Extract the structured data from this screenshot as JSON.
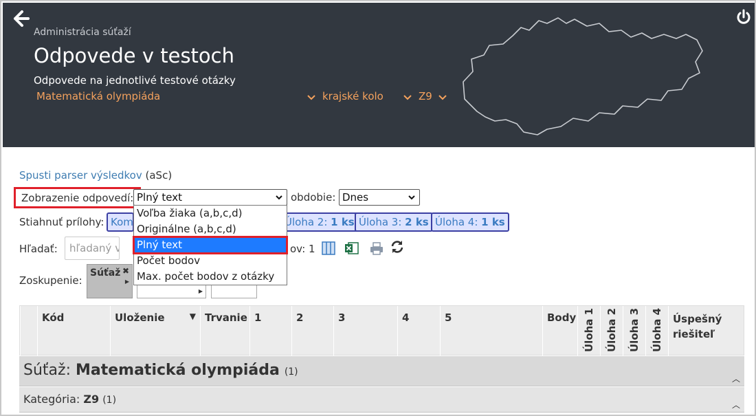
{
  "header": {
    "section": "Administrácia súťaží",
    "title": "Odpovede v testoch",
    "subtitle": "Odpovede na jednotlivé testové otázky",
    "competition": "Matematická olympiáda",
    "round": "krajské kolo",
    "category": "Z9"
  },
  "toolbar": {
    "parser_link": "Spusti parser výsledkov",
    "parser_suffix": "(aSc)",
    "display_label": "Zobrazenie odpovedí:",
    "display_value": "Plný text",
    "period_label": "obdobie:",
    "period_value": "Dnes",
    "attachments_label": "Stiahnuť prílohy:",
    "tag_komplet": "Kom",
    "tag_u2_label": "Úloha 2:",
    "tag_u2_count": "1 ks",
    "tag_u3_label": "Úloha 3:",
    "tag_u3_count": "2 ks",
    "tag_u4_label": "Úloha 4:",
    "tag_u4_count": "1 ks",
    "search_label": "Hľadať:",
    "search_placeholder": "hľadaný výr",
    "count_text": "ov: 1",
    "grouping_label": "Zoskupenie:",
    "group_chip": "Súťaž"
  },
  "dropdown": {
    "options": [
      "Voľba žiaka (a,b,c,d)",
      "Originálne (a,b,c,d)",
      "Plný text",
      "Počet bodov",
      "Max. počet bodov z otázky"
    ]
  },
  "table": {
    "columns": [
      "Kód",
      "Uloženie",
      "Trvanie",
      "1",
      "2",
      "3",
      "4",
      "5",
      "Body",
      "Úloha 1",
      "Úloha 2",
      "Úloha 3",
      "Úloha 4",
      "Úspešný riešiteľ"
    ],
    "group1_label": "Súťaž:",
    "group1_value": "Matematická olympiáda",
    "group1_count": "(1)",
    "group2_label": "Kategória:",
    "group2_value": "Z9",
    "group2_count": "(1)"
  },
  "colors": {
    "header_bg": "#323840",
    "accent": "#f5a25d",
    "highlight": "#e0202a",
    "selected": "#1e7bff"
  }
}
